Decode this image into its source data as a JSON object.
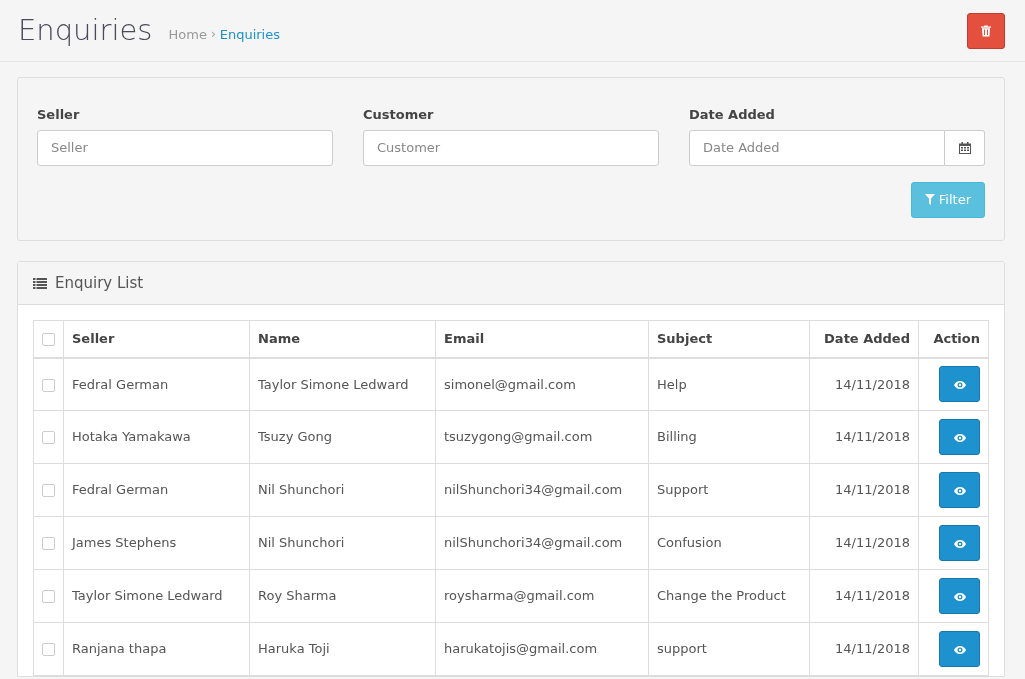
{
  "page": {
    "title": "Enquiries"
  },
  "breadcrumb_separator": "›",
  "breadcrumb": [
    {
      "label": "Home",
      "selected": false
    },
    {
      "label": "Enquiries",
      "selected": true
    }
  ],
  "filter": {
    "fields": [
      {
        "kind": "text",
        "label": "Seller",
        "placeholder": "Seller"
      },
      {
        "kind": "text",
        "label": "Customer",
        "placeholder": "Customer"
      },
      {
        "kind": "date",
        "label": "Date Added",
        "placeholder": "Date Added"
      }
    ],
    "button": "Filter"
  },
  "list": {
    "title": "Enquiry List",
    "select_all": {
      "checked": false
    },
    "columns": [
      {
        "kind": "text",
        "label": "Seller"
      },
      {
        "kind": "text",
        "label": "Name"
      },
      {
        "kind": "text",
        "label": "Email"
      },
      {
        "kind": "text",
        "label": "Subject"
      },
      {
        "kind": "date",
        "label": "Date Added"
      },
      {
        "kind": "action",
        "label": "Action"
      }
    ],
    "rows": [
      {
        "checked": false,
        "cells": [
          "Fedral German",
          "Taylor Simone Ledward",
          "simonel@gmail.com",
          "Help",
          "14/11/2018"
        ]
      },
      {
        "checked": false,
        "cells": [
          "Hotaka Yamakawa",
          "Tsuzy Gong",
          "tsuzygong@gmail.com",
          "Billing",
          "14/11/2018"
        ]
      },
      {
        "checked": false,
        "cells": [
          "Fedral German",
          "Nil Shunchori",
          "nilShunchori34@gmail.com",
          "Support",
          "14/11/2018"
        ]
      },
      {
        "checked": false,
        "cells": [
          "James Stephens",
          "Nil Shunchori",
          "nilShunchori34@gmail.com",
          "Confusion",
          "14/11/2018"
        ]
      },
      {
        "checked": false,
        "cells": [
          "Taylor Simone Ledward",
          "Roy Sharma",
          "roysharma@gmail.com",
          "Change the Product",
          "14/11/2018"
        ]
      },
      {
        "checked": false,
        "cells": [
          "Ranjana thapa",
          "Haruka Toji",
          "harukatojis@gmail.com",
          "support",
          "14/11/2018"
        ]
      }
    ]
  }
}
